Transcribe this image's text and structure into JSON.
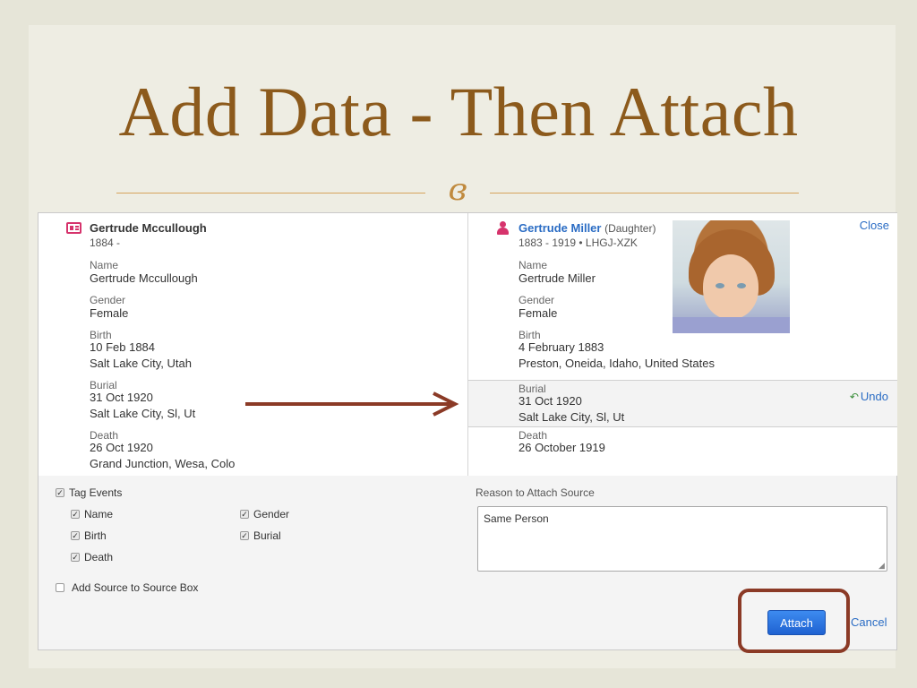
{
  "slide": {
    "title": "Add Data - Then Attach",
    "ornament": "ɞ"
  },
  "left": {
    "name": "Gertrude Mccullough",
    "lifespan": "1884 -",
    "fields": [
      {
        "label": "Name",
        "values": [
          "Gertrude Mccullough"
        ]
      },
      {
        "label": "Gender",
        "values": [
          "Female"
        ]
      },
      {
        "label": "Birth",
        "values": [
          "10 Feb 1884",
          "Salt Lake City, Utah"
        ]
      },
      {
        "label": "Burial",
        "values": [
          "31 Oct 1920",
          "Salt Lake City, Sl, Ut"
        ]
      },
      {
        "label": "Death",
        "values": [
          "26 Oct 1920",
          "Grand Junction, Wesa, Colo"
        ]
      }
    ]
  },
  "right": {
    "name": "Gertrude Miller",
    "relationship": "(Daughter)",
    "lifespan": "1883 - 1919 • LHGJ-XZK",
    "close_label": "Close",
    "undo_label": "Undo",
    "fields": [
      {
        "label": "Name",
        "values": [
          "Gertrude Miller"
        ]
      },
      {
        "label": "Gender",
        "values": [
          "Female"
        ]
      },
      {
        "label": "Birth",
        "values": [
          "4 February 1883",
          "Preston, Oneida, Idaho, United States"
        ]
      },
      {
        "label": "Burial",
        "values": [
          "31 Oct 1920",
          "Salt Lake City, Sl, Ut"
        ]
      },
      {
        "label": "Death",
        "values": [
          "26 October 1919"
        ]
      }
    ]
  },
  "tagging": {
    "tag_events_label": "Tag Events",
    "options": [
      {
        "label": "Name",
        "checked": true
      },
      {
        "label": "Gender",
        "checked": true
      },
      {
        "label": "Birth",
        "checked": true
      },
      {
        "label": "Burial",
        "checked": true
      },
      {
        "label": "Death",
        "checked": true
      }
    ],
    "add_source_label": "Add Source to Source Box",
    "add_source_checked": false
  },
  "reason": {
    "label": "Reason to Attach Source",
    "value": "Same Person"
  },
  "actions": {
    "attach_label": "Attach",
    "cancel_label": "Cancel"
  },
  "colors": {
    "title": "#8c5a1c",
    "link": "#2a6cc4",
    "arrow": "#8b3a26",
    "attach_button": "#1f62d1"
  }
}
